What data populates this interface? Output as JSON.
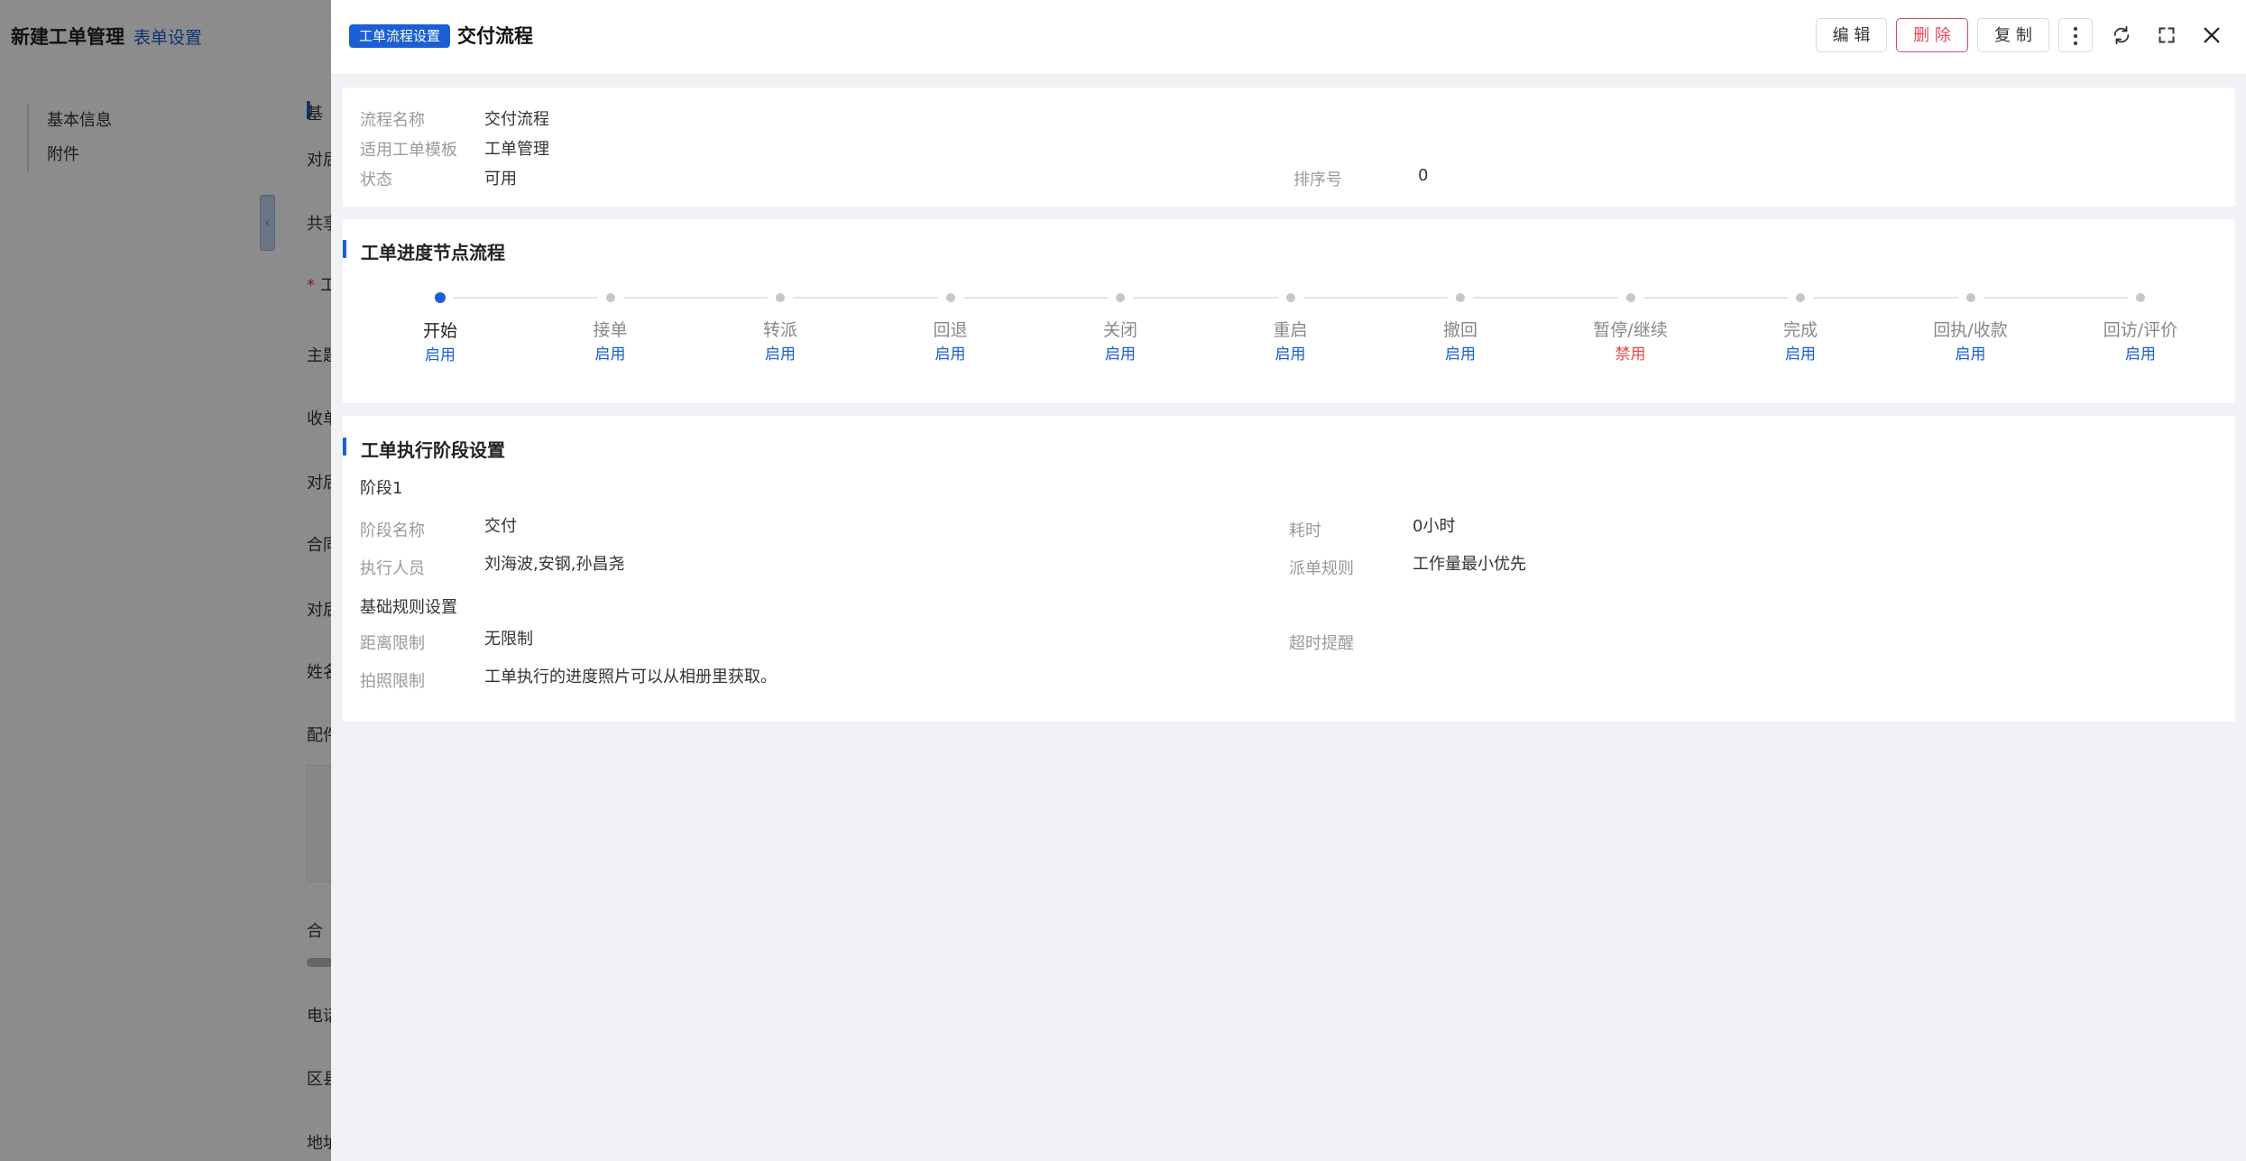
{
  "background": {
    "title": "新建工单管理",
    "subtitle": "表单设置",
    "side_items": [
      "基本信息",
      "附件"
    ],
    "form_labels": [
      {
        "text": "基",
        "required": false
      },
      {
        "text": "对后",
        "required": false
      },
      {
        "text": "共享",
        "required": false
      },
      {
        "text": "工",
        "required": true
      },
      {
        "text": "主题",
        "required": false
      },
      {
        "text": "收单",
        "required": false
      },
      {
        "text": "对后",
        "required": false
      },
      {
        "text": "合同",
        "required": false
      },
      {
        "text": "对后",
        "required": false
      },
      {
        "text": "姓名",
        "required": false
      },
      {
        "text": "配件",
        "required": false
      },
      {
        "text": "合",
        "required": false
      },
      {
        "text": "电话",
        "required": false
      },
      {
        "text": "区县",
        "required": false
      },
      {
        "text": "地址",
        "required": false
      }
    ]
  },
  "drawer": {
    "tag": "工单流程设置",
    "title": "交付流程",
    "actions": {
      "edit": "编 辑",
      "delete": "删 除",
      "copy": "复 制"
    },
    "icons": [
      "more-icon",
      "refresh-icon",
      "fullscreen-icon",
      "close-icon"
    ],
    "info": {
      "flow_name_label": "流程名称",
      "flow_name": "交付流程",
      "template_label": "适用工单模板",
      "template": "工单管理",
      "status_label": "状态",
      "status": "可用",
      "order_label": "排序号",
      "order": "0"
    },
    "progress": {
      "title": "工单进度节点流程",
      "steps": [
        {
          "name": "开始",
          "status": "启用",
          "enabled": true
        },
        {
          "name": "接单",
          "status": "启用",
          "enabled": true
        },
        {
          "name": "转派",
          "status": "启用",
          "enabled": true
        },
        {
          "name": "回退",
          "status": "启用",
          "enabled": true
        },
        {
          "name": "关闭",
          "status": "启用",
          "enabled": true
        },
        {
          "name": "重启",
          "status": "启用",
          "enabled": true
        },
        {
          "name": "撤回",
          "status": "启用",
          "enabled": true
        },
        {
          "name": "暂停/继续",
          "status": "禁用",
          "enabled": false
        },
        {
          "name": "完成",
          "status": "启用",
          "enabled": true
        },
        {
          "name": "回执/收款",
          "status": "启用",
          "enabled": true
        },
        {
          "name": "回访/评价",
          "status": "启用",
          "enabled": true
        }
      ]
    },
    "stages": {
      "title": "工单执行阶段设置",
      "stage_label": "阶段1",
      "name_label": "阶段名称",
      "name": "交付",
      "duration_label": "耗时",
      "duration": "0小时",
      "executor_label": "执行人员",
      "executor": "刘海波,安钢,孙昌尧",
      "dispatch_label": "派单规则",
      "dispatch": "工作量最小优先",
      "basic_rules": "基础规则设置",
      "distance_label": "距离限制",
      "distance": "无限制",
      "timeout_label": "超时提醒",
      "timeout": "",
      "photo_label": "拍照限制",
      "photo": "工单执行的进度照片可以从相册里获取。"
    },
    "colors": {
      "accent": "#1a5fd6",
      "danger": "#e0475a",
      "enabled": "#1a5fd6",
      "disabled": "#e84a4a"
    }
  }
}
